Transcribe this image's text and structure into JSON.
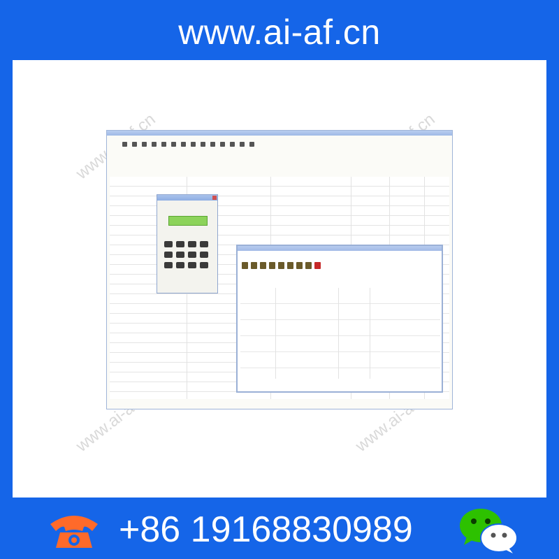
{
  "banner": {
    "website": "www.ai-af.cn"
  },
  "contact": {
    "phone": "+86 19168830989"
  },
  "watermarks": [
    "www.ai-af.cn",
    "www.ai-af.cn",
    "www.ai-af.cn",
    "www.ai-af.cn"
  ],
  "colors": {
    "brand_blue": "#1565e8",
    "phone_orange": "#ff6a2a",
    "wechat_green": "#2dc100",
    "calc_display_green": "#8cd35a"
  },
  "icons": {
    "phone": "phone-icon",
    "wechat": "wechat-icon"
  }
}
